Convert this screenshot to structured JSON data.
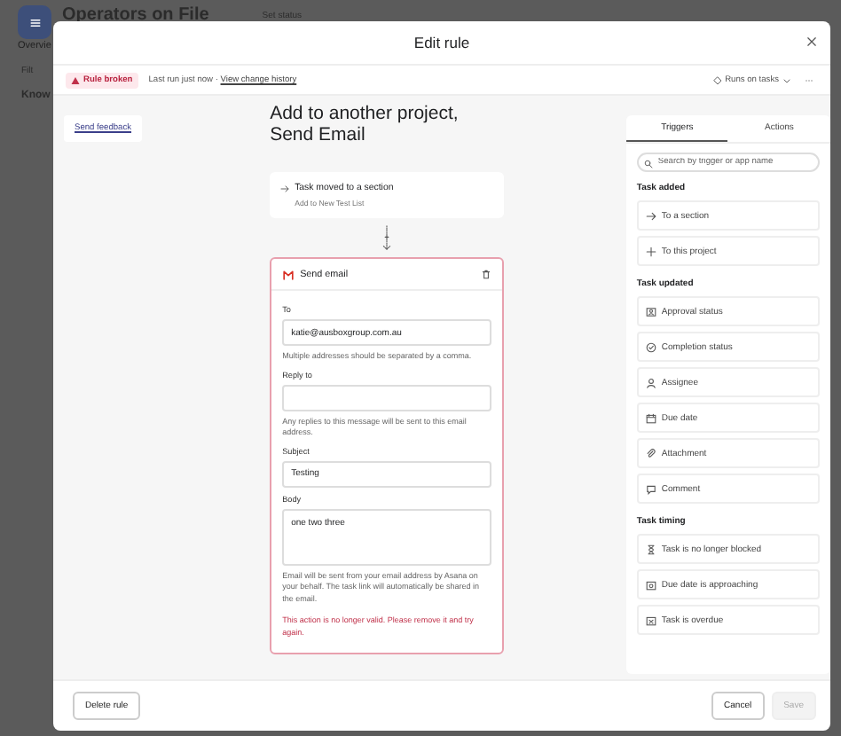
{
  "background": {
    "app_title": "Operators on File",
    "set_status": "Set status",
    "tab": "Overvie",
    "filter": "Filt",
    "section": "Know"
  },
  "window": {
    "title": "Edit rule"
  },
  "status": {
    "badge": "Rule broken",
    "last_run": "Last run just now · ",
    "history_link": "View change history",
    "runs_on": "Runs on tasks"
  },
  "send_feedback": "Send feedback",
  "rule": {
    "title": "Add to another project, Send Email",
    "trigger": {
      "title": "Task moved to a section",
      "subtitle": "Add to New Test List"
    },
    "action": {
      "title": "Send email",
      "fields": [
        {
          "kind": "input",
          "label": "To",
          "value": "katie@ausboxgroup.com.au",
          "hint": "Multiple addresses should be separated by a comma."
        },
        {
          "kind": "input",
          "label": "Reply to",
          "hint": "Any replies to this message will be sent to this email address."
        },
        {
          "kind": "input",
          "label": "Subject",
          "value": "Testing"
        },
        {
          "kind": "textarea",
          "label": "Body",
          "value": "one two three",
          "hint": "Email will be sent from your email address by Asana on your behalf. The task link will automatically be shared in the email."
        }
      ],
      "error": "This action is no longer valid. Please remove it and try again."
    }
  },
  "panel": {
    "tabs": [
      {
        "label": "Triggers",
        "selected": true
      },
      {
        "label": "Actions",
        "selected": false
      }
    ],
    "search": {
      "placeholder": "Search by trigger or app name"
    },
    "groups": [
      {
        "title": "Task added",
        "items": [
          "To a section",
          "To this project"
        ]
      },
      {
        "title": "Task updated",
        "items": [
          "Approval status",
          "Completion status",
          "Assignee",
          "Due date",
          "Attachment",
          "Comment"
        ]
      },
      {
        "title": "Task timing",
        "items": [
          "Task is no longer blocked",
          "Due date is approaching",
          "Task is overdue"
        ]
      }
    ]
  },
  "footer": {
    "delete": "Delete rule",
    "cancel": "Cancel",
    "save": "Save",
    "save_disabled": true
  }
}
